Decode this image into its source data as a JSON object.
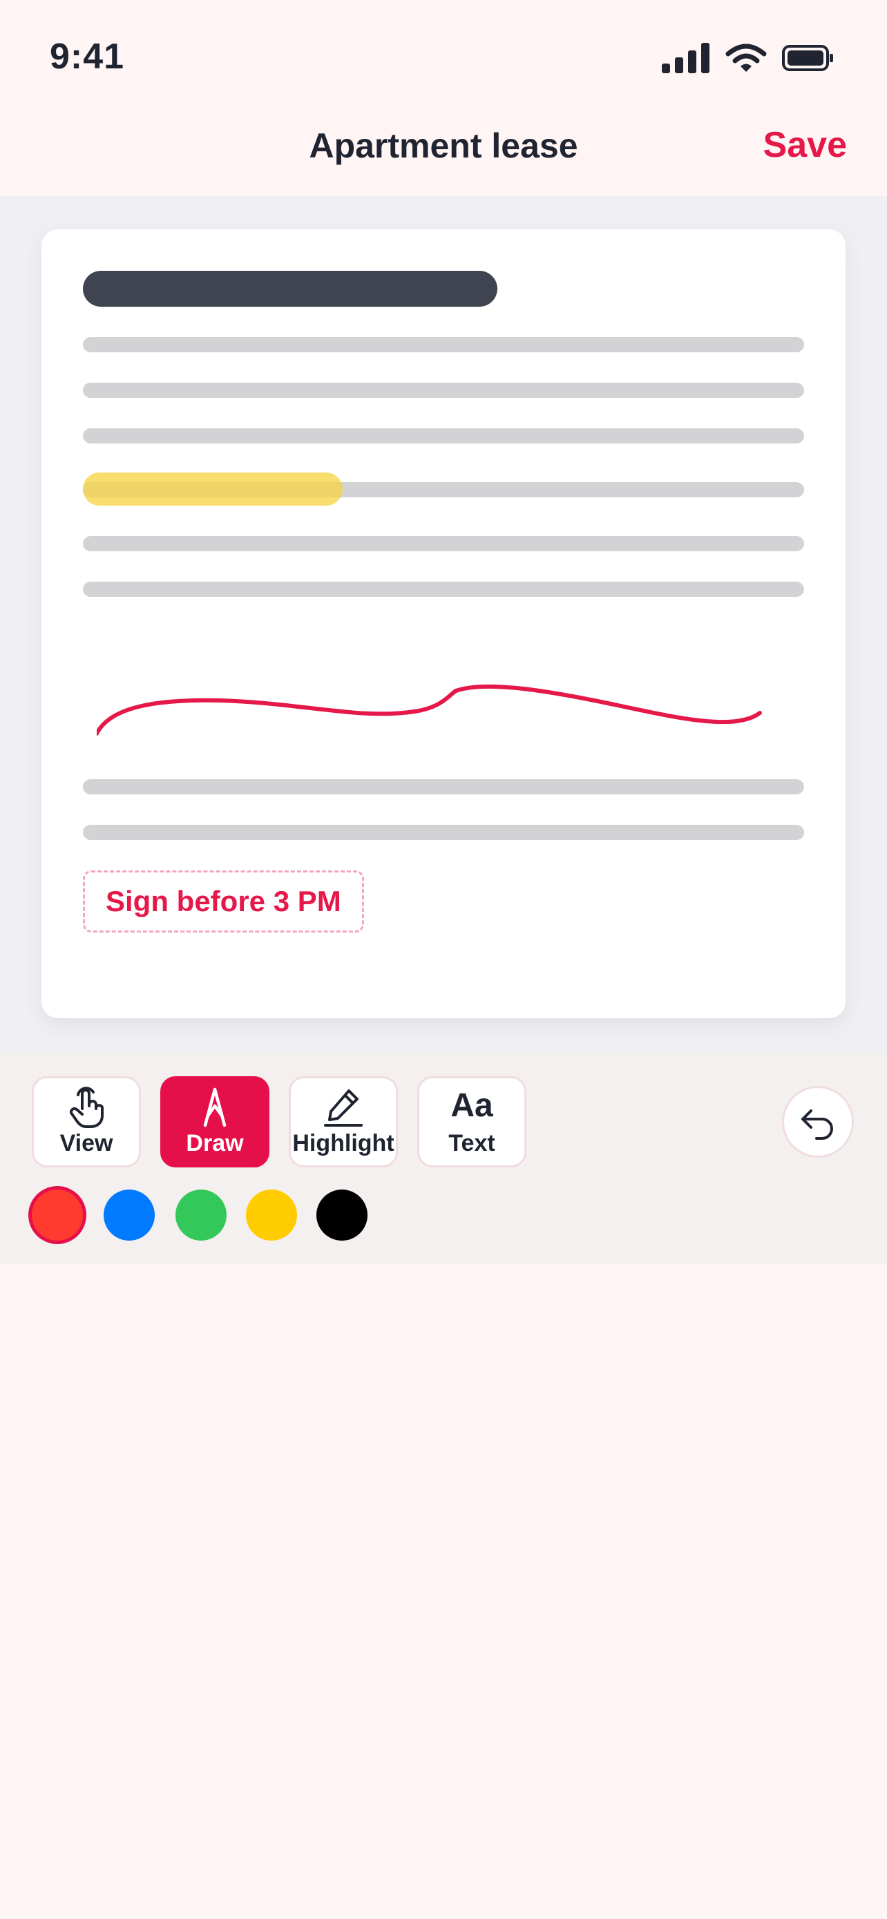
{
  "status_bar": {
    "time": "9:41"
  },
  "nav": {
    "title": "Apartment lease",
    "save_label": "Save"
  },
  "document": {
    "note_text": "Sign before 3 PM",
    "highlight_progress": 0.36,
    "accent_color": "#e5184a",
    "highlight_color": "#f6d346"
  },
  "tools": [
    {
      "label": "View",
      "icon": "hand-pointer-icon",
      "active": false
    },
    {
      "label": "Draw",
      "icon": "compass-pen-icon",
      "active": true
    },
    {
      "label": "Highlight",
      "icon": "pencil-icon",
      "active": false
    },
    {
      "label": "Text",
      "icon": "text-aa-icon",
      "glyph": "Aa",
      "active": false
    }
  ],
  "undo": {
    "icon": "undo-icon"
  },
  "colors": [
    {
      "name": "red",
      "hex": "#ff3b30",
      "selected": true
    },
    {
      "name": "blue",
      "hex": "#007aff",
      "selected": false
    },
    {
      "name": "green",
      "hex": "#34c759",
      "selected": false
    },
    {
      "name": "yellow",
      "hex": "#ffcc00",
      "selected": false
    },
    {
      "name": "black",
      "hex": "#000000",
      "selected": false
    }
  ]
}
